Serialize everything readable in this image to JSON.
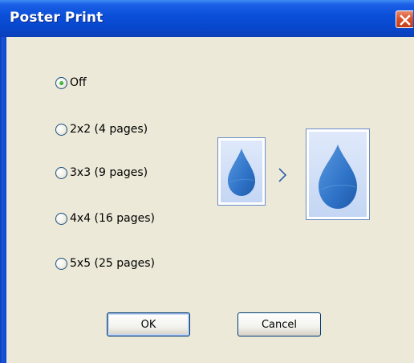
{
  "window": {
    "title": "Poster Print"
  },
  "options": [
    {
      "label": "Off",
      "selected": true
    },
    {
      "label": "2x2 (4 pages)",
      "selected": false
    },
    {
      "label": "3x3 (9 pages)",
      "selected": false
    },
    {
      "label": "4x4 (16 pages)",
      "selected": false
    },
    {
      "label": "5x5 (25 pages)",
      "selected": false
    }
  ],
  "buttons": {
    "ok_label": "OK",
    "cancel_label": "Cancel"
  },
  "icons": {
    "close": "close-icon",
    "preview_small": "droplet-icon",
    "preview_large": "droplet-icon",
    "arrow": "chevron-right-icon"
  },
  "colors": {
    "titlebar": "#0a4ed8",
    "dialog_bg": "#ece9d8",
    "close_button": "#d9522e",
    "radio_selected": "#21a121",
    "droplet": "#2f73c8"
  }
}
